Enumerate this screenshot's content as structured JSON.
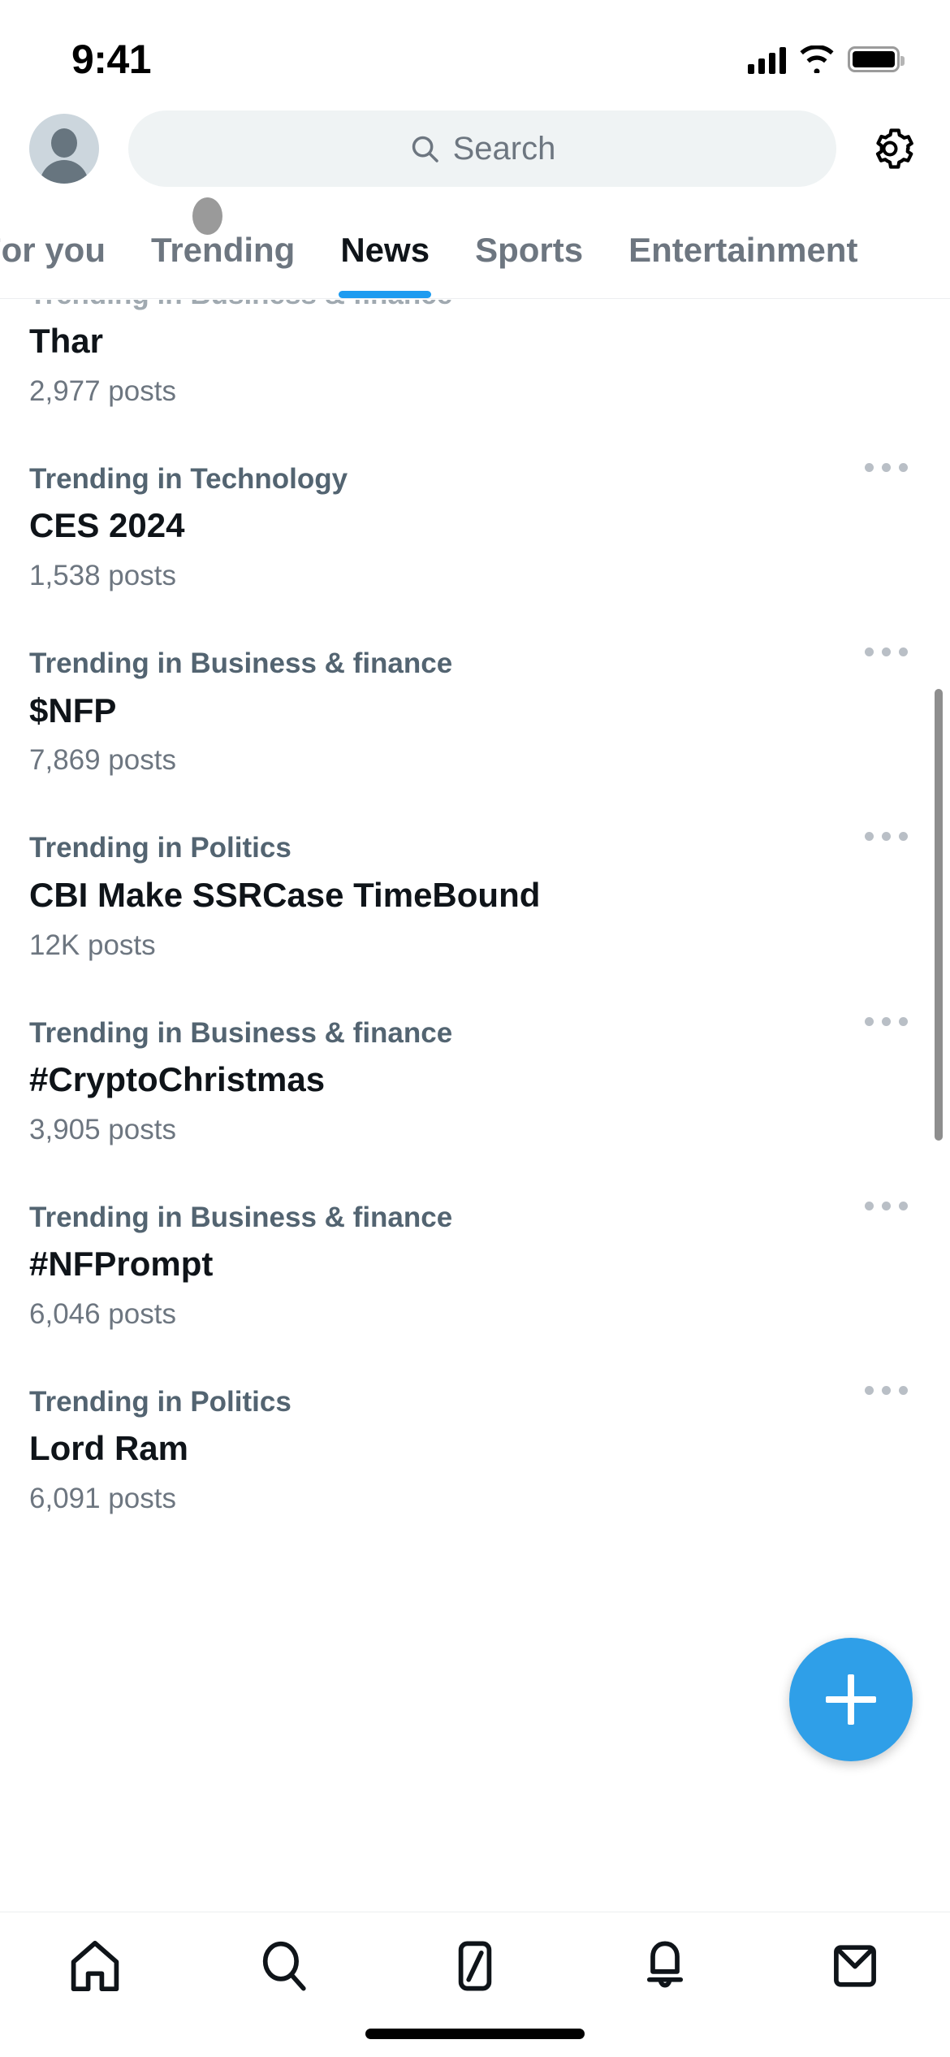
{
  "status_bar": {
    "time": "9:41",
    "signal_icon": "cellular-signal-icon",
    "wifi_icon": "wifi-icon",
    "battery_icon": "battery-full-icon"
  },
  "top_bar": {
    "avatar_label": "profile-avatar",
    "search": {
      "placeholder": "Search",
      "value": "",
      "icon": "search-icon"
    },
    "settings_icon": "gear-icon"
  },
  "tabs": {
    "items": [
      {
        "label": "For you",
        "active": false,
        "clipped": true
      },
      {
        "label": "Trending",
        "active": false
      },
      {
        "label": "News",
        "active": true
      },
      {
        "label": "Sports",
        "active": false
      },
      {
        "label": "Entertainment",
        "active": false,
        "clipped": true
      }
    ],
    "active_index": 2,
    "indicator_color": "#1d9bf0"
  },
  "trends": [
    {
      "category": "Trending in Business & finance",
      "name": "Thar",
      "posts": "2,977 posts",
      "clipped": true,
      "menu": false
    },
    {
      "category": "Trending in Technology",
      "name": "CES 2024",
      "posts": "1,538 posts",
      "clipped": false,
      "menu": true
    },
    {
      "category": "Trending in Business & finance",
      "name": "$NFP",
      "posts": "7,869 posts",
      "clipped": false,
      "menu": true
    },
    {
      "category": "Trending in Politics",
      "name": "CBI Make SSRCase TimeBound",
      "posts": "12K posts",
      "clipped": false,
      "menu": true
    },
    {
      "category": "Trending in Business & finance",
      "name": "#CryptoChristmas",
      "posts": "3,905 posts",
      "clipped": false,
      "menu": true
    },
    {
      "category": "Trending in Business & finance",
      "name": "#NFPrompt",
      "posts": "6,046 posts",
      "clipped": false,
      "menu": true
    },
    {
      "category": "Trending in Politics",
      "name": "Lord Ram",
      "posts": "6,091 posts",
      "clipped": false,
      "menu": true
    }
  ],
  "compose_fab": {
    "icon": "plus-icon",
    "color": "#2f9fe8"
  },
  "bottom_nav": {
    "items": [
      {
        "name": "home",
        "icon": "home-icon",
        "active": true
      },
      {
        "name": "search",
        "icon": "search-icon",
        "active": false
      },
      {
        "name": "grok",
        "icon": "grok-icon",
        "active": false
      },
      {
        "name": "notifications",
        "icon": "bell-icon",
        "active": false
      },
      {
        "name": "messages",
        "icon": "envelope-icon",
        "active": false
      }
    ]
  },
  "colors": {
    "accent": "#1d9bf0",
    "fab": "#2f9fe8",
    "text_primary": "#0f1419",
    "text_secondary": "#536471",
    "text_muted": "#6d7680",
    "search_bg": "#eff3f4",
    "divider": "#eceef0",
    "scrollbar": "#8e8e8e"
  }
}
